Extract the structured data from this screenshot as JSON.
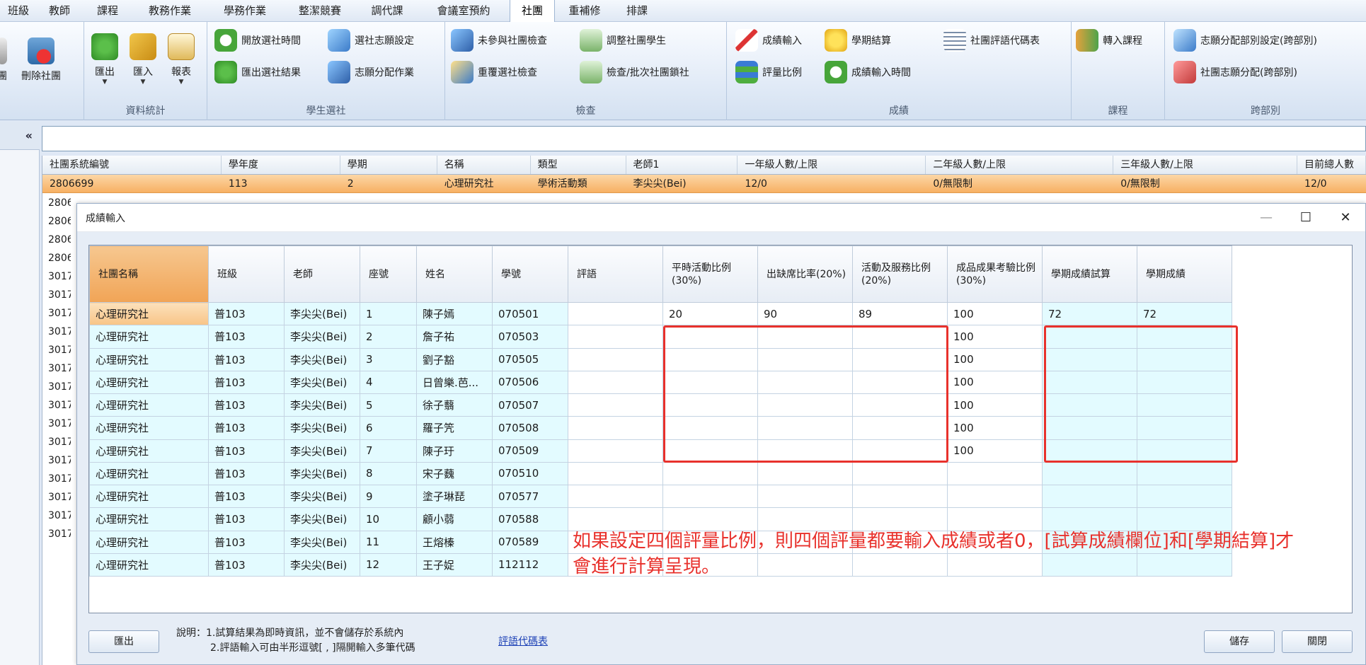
{
  "menu": {
    "tabs": [
      "班級",
      "教師",
      "課程",
      "教務作業",
      "學務作業",
      "整潔競賽",
      "調代課",
      "會議室預約",
      "社團",
      "重補修",
      "排課"
    ],
    "active_index": 8
  },
  "ribbon": {
    "groups": {
      "g0": {
        "title": ""
      },
      "g1": {
        "title": "資料統計"
      },
      "g2": {
        "title": "學生選社"
      },
      "g3": {
        "title": "檢查"
      },
      "g4": {
        "title": "成績"
      },
      "g5": {
        "title": "課程"
      },
      "g6": {
        "title": "跨部別"
      }
    },
    "buttons": {
      "club_partial": "團",
      "delete_club": "刪除社團",
      "export": "匯出",
      "import": "匯入",
      "report": "報表",
      "open_time": "開放選社時間",
      "wish_setting": "選社志願設定",
      "export_result": "匯出選社結果",
      "wish_assign": "志願分配作業",
      "unjoined_check": "未參與社團檢查",
      "adjust_students": "調整社團學生",
      "dup_check": "重覆選社檢查",
      "check_lock": "檢查/批次社團鎖社",
      "score_input": "成績輸入",
      "semester_settle": "學期結算",
      "comment_codes": "社團評語代碼表",
      "weight_ratio": "評量比例",
      "score_time": "成績輸入時間",
      "transfer_course": "轉入課程",
      "cross_setting": "志願分配部別設定(跨部別)",
      "cross_assign": "社團志願分配(跨部別)"
    }
  },
  "sidebar": {
    "collapse_glyph": "«"
  },
  "background_grid": {
    "headers": [
      "社團系統編號",
      "學年度",
      "學期",
      "名稱",
      "類型",
      "老師1",
      "一年級人數/上限",
      "二年級人數/上限",
      "三年級人數/上限",
      "目前總人數"
    ],
    "selected_row": [
      "2806699",
      "113",
      "2",
      "心理研究社",
      "學術活動類",
      "李尖尖(Bei)",
      "12/0",
      "0/無限制",
      "0/無限制",
      "12/0"
    ],
    "partial_ids": [
      "2806",
      "2806",
      "2806",
      "2806",
      "3017",
      "3017",
      "3017",
      "3017",
      "3017",
      "3017",
      "3017",
      "3017",
      "3017",
      "3017",
      "3017",
      "3017",
      "3017",
      "3017",
      "3017"
    ]
  },
  "dialog": {
    "title": "成績輸入",
    "columns": [
      "社團名稱",
      "班級",
      "老師",
      "座號",
      "姓名",
      "學號",
      "評語",
      "平時活動比例(30%)",
      "出缺席比率(20%)",
      "活動及服務比例(20%)",
      "成品成果考驗比例(30%)",
      "學期成績試算",
      "學期成績"
    ],
    "rows": [
      [
        "心理研究社",
        "普103",
        "李尖尖(Bei)",
        "1",
        "陳子嫣",
        "070501",
        "",
        "20",
        "90",
        "89",
        "100",
        "72",
        "72"
      ],
      [
        "心理研究社",
        "普103",
        "李尖尖(Bei)",
        "2",
        "詹子祐",
        "070503",
        "",
        "",
        "",
        "",
        "100",
        "",
        ""
      ],
      [
        "心理研究社",
        "普103",
        "李尖尖(Bei)",
        "3",
        "劉子豁",
        "070505",
        "",
        "",
        "",
        "",
        "100",
        "",
        ""
      ],
      [
        "心理研究社",
        "普103",
        "李尖尖(Bei)",
        "4",
        "日曾樂.芭...",
        "070506",
        "",
        "",
        "",
        "",
        "100",
        "",
        ""
      ],
      [
        "心理研究社",
        "普103",
        "李尖尖(Bei)",
        "5",
        "徐子蘙",
        "070507",
        "",
        "",
        "",
        "",
        "100",
        "",
        ""
      ],
      [
        "心理研究社",
        "普103",
        "李尖尖(Bei)",
        "6",
        "羅子笐",
        "070508",
        "",
        "",
        "",
        "",
        "100",
        "",
        ""
      ],
      [
        "心理研究社",
        "普103",
        "李尖尖(Bei)",
        "7",
        "陳子玗",
        "070509",
        "",
        "",
        "",
        "",
        "100",
        "",
        ""
      ],
      [
        "心理研究社",
        "普103",
        "李尖尖(Bei)",
        "8",
        "宋子蘶",
        "070510",
        "",
        "",
        "",
        "",
        "",
        "",
        ""
      ],
      [
        "心理研究社",
        "普103",
        "李尖尖(Bei)",
        "9",
        "塗子琳琵",
        "070577",
        "",
        "",
        "",
        "",
        "",
        "",
        ""
      ],
      [
        "心理研究社",
        "普103",
        "李尖尖(Bei)",
        "10",
        "顧小蒻",
        "070588",
        "",
        "",
        "",
        "",
        "",
        "",
        ""
      ],
      [
        "心理研究社",
        "普103",
        "李尖尖(Bei)",
        "11",
        "王熔榛",
        "070589",
        "",
        "",
        "",
        "",
        "",
        "",
        ""
      ],
      [
        "心理研究社",
        "普103",
        "李尖尖(Bei)",
        "12",
        "王子娖",
        "112112",
        "",
        "",
        "",
        "",
        "",
        "",
        ""
      ]
    ],
    "note_line1": "如果設定四個評量比例，則四個評量都要輸入成績或者0，[試算成績欄位]和[學期結算]才",
    "note_line2": "會進行計算呈現。",
    "footer": {
      "export_label": "匯出",
      "desc_line1": "說明：1.試算結果為即時資訊，並不會儲存於系統內",
      "desc_line2": "2.評語輸入可由半形逗號[ , ]隔開輸入多筆代碼",
      "code_link": "評語代碼表",
      "save_label": "儲存",
      "close_label": "關閉"
    },
    "window_controls": {
      "minimize": "—",
      "maximize": "☐",
      "close": "✕"
    }
  },
  "colors": {
    "accent_orange": "#f7b063",
    "highlight_red": "#e8312c",
    "row_cyan": "#e3fbff"
  }
}
